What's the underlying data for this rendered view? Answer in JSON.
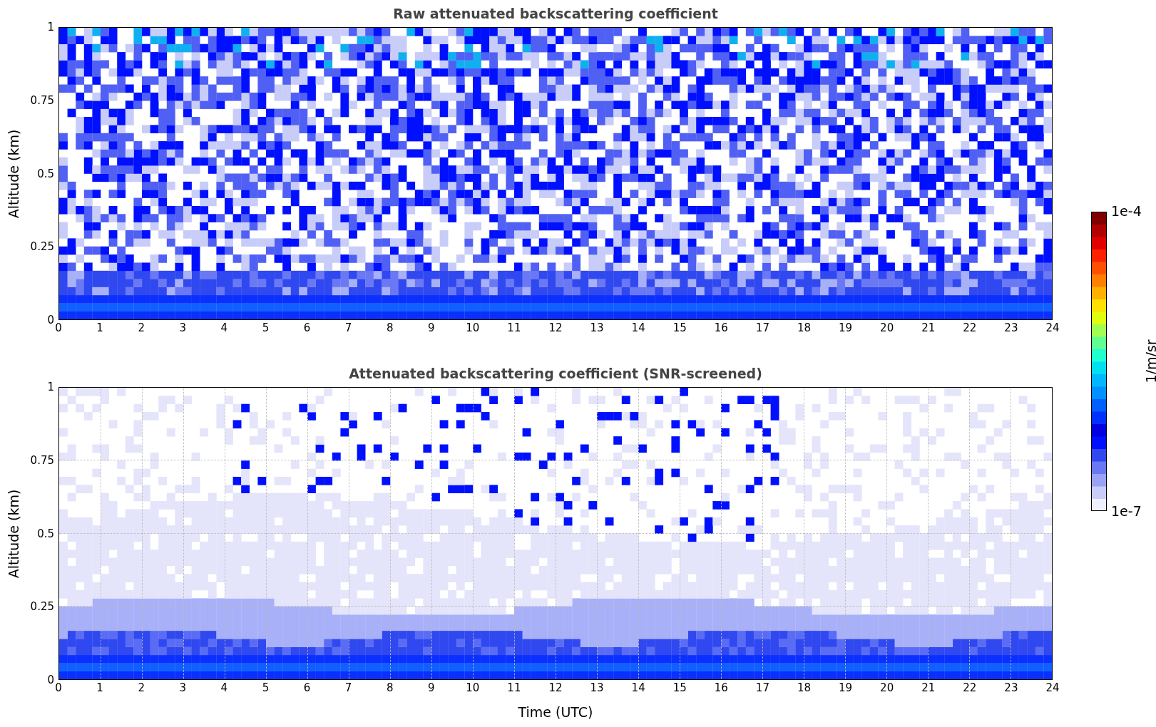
{
  "panels": [
    {
      "kind": "raw",
      "title": "Raw attenuated backscattering coefficient",
      "ylabel": "Altitude (km)",
      "yticks": [
        "1",
        "0.75",
        "0.5",
        "0.25",
        "0"
      ],
      "xticks": [
        "0",
        "1",
        "2",
        "3",
        "4",
        "5",
        "6",
        "7",
        "8",
        "9",
        "10",
        "11",
        "12",
        "13",
        "14",
        "15",
        "16",
        "17",
        "18",
        "19",
        "20",
        "21",
        "22",
        "23",
        "24"
      ]
    },
    {
      "kind": "screened",
      "title": "Attenuated backscattering coefficient (SNR-screened)",
      "ylabel": "Altitude (km)",
      "yticks": [
        "1",
        "0.75",
        "0.5",
        "0.25",
        "0"
      ],
      "xticks": [
        "0",
        "1",
        "2",
        "3",
        "4",
        "5",
        "6",
        "7",
        "8",
        "9",
        "10",
        "11",
        "12",
        "13",
        "14",
        "15",
        "16",
        "17",
        "18",
        "19",
        "20",
        "21",
        "22",
        "23",
        "24"
      ]
    }
  ],
  "xlabel": "Time (UTC)",
  "colorbar": {
    "max_label": "1e-4",
    "min_label": "1e-7",
    "unit": "1/m/sr"
  }
}
